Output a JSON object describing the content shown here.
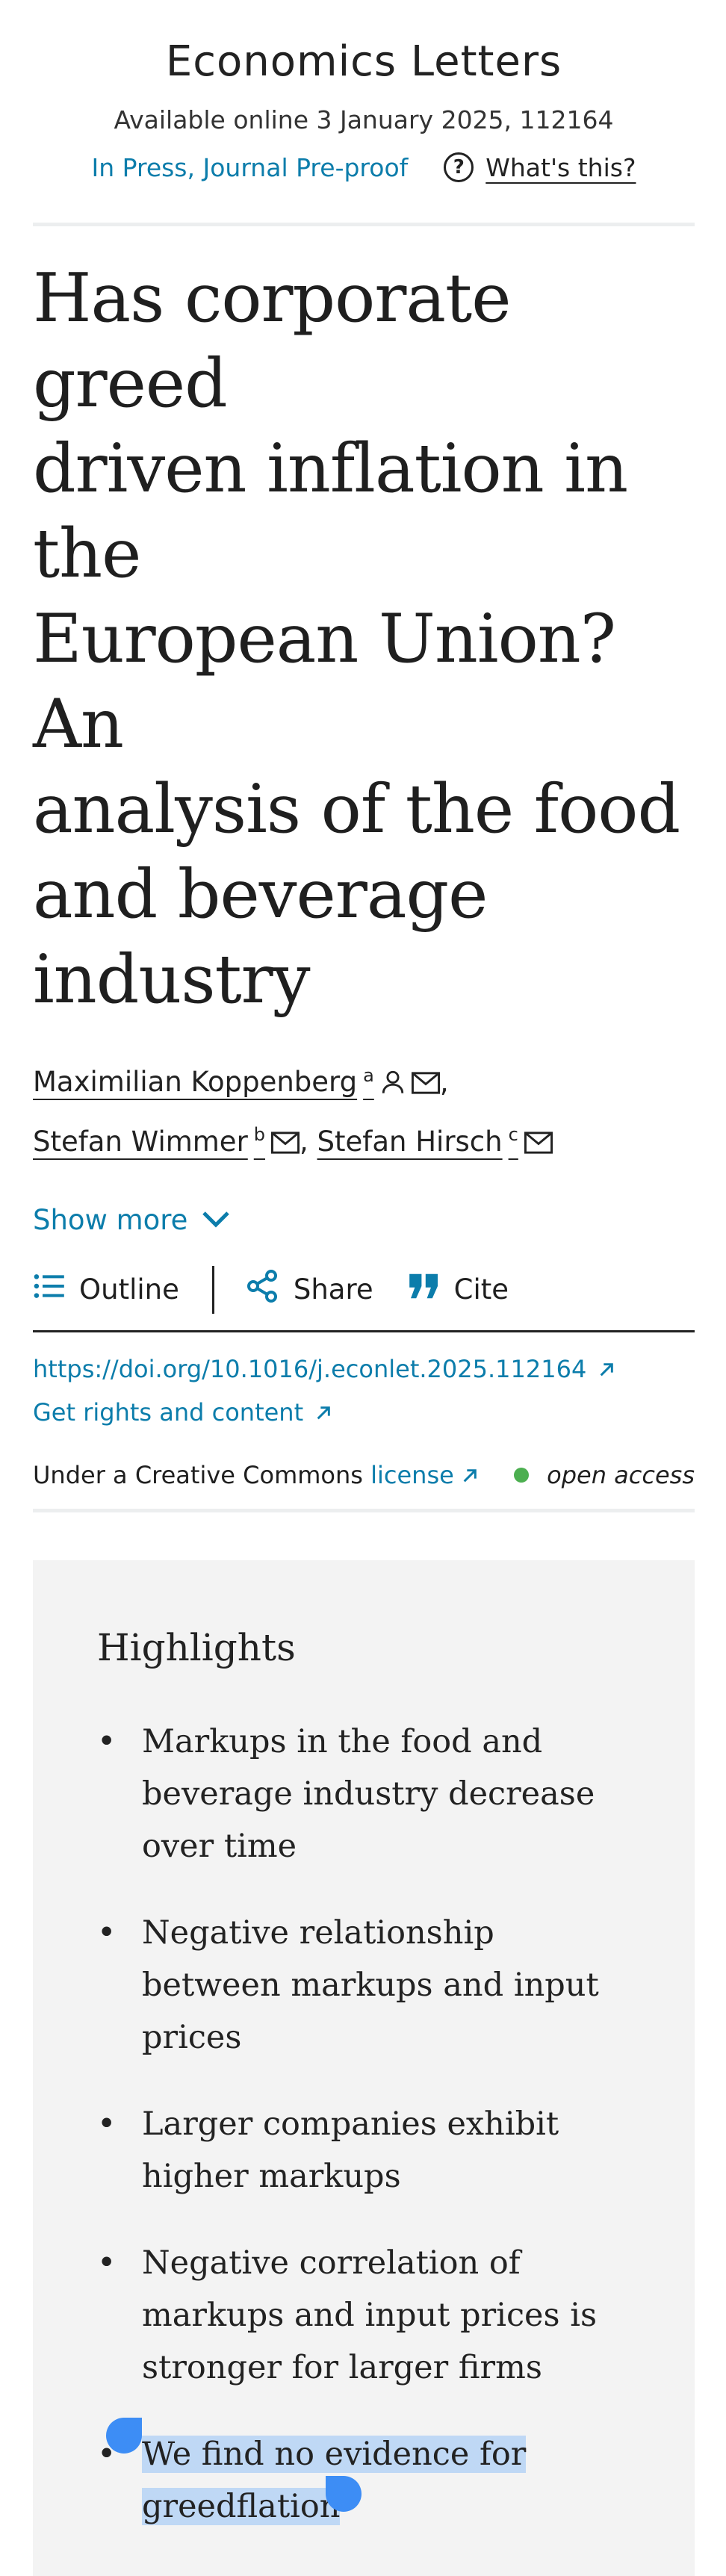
{
  "journal": {
    "name": "Economics Letters",
    "availability": "Available online 3 January 2025, 112164",
    "status": "In Press, Journal Pre-proof",
    "whats_this": "What's this?"
  },
  "article": {
    "title_lines": [
      "Has corporate greed",
      "driven inflation in the",
      "European Union? An",
      "analysis of the food",
      "and beverage industry"
    ],
    "authors": [
      {
        "name": "Maximilian Koppenberg",
        "affiliation": "a"
      },
      {
        "name": "Stefan Wimmer",
        "affiliation": "b"
      },
      {
        "name": "Stefan Hirsch",
        "affiliation": "c"
      }
    ],
    "show_more": "Show more"
  },
  "toolbar": {
    "outline": "Outline",
    "share": "Share",
    "cite": "Cite"
  },
  "links": {
    "doi": "https://doi.org/10.1016/j.econlet.2025.112164",
    "rights": "Get rights and content",
    "license_prefix": "Under a Creative Commons",
    "license_link": "license",
    "open_access": "open access"
  },
  "highlights": {
    "title": "Highlights",
    "items": [
      "Markups in the food and beverage industry decrease over time",
      "Negative relationship between markups and input prices",
      "Larger companies exhibit higher markups",
      "Negative correlation of markups and input prices is stronger for larger firms",
      "We find no evidence for greedflation"
    ]
  },
  "colors": {
    "link": "#0c7dab",
    "selection": "#bfd8f5",
    "selection_handle": "#3d8df5",
    "open_access_dot": "#4caf50"
  }
}
